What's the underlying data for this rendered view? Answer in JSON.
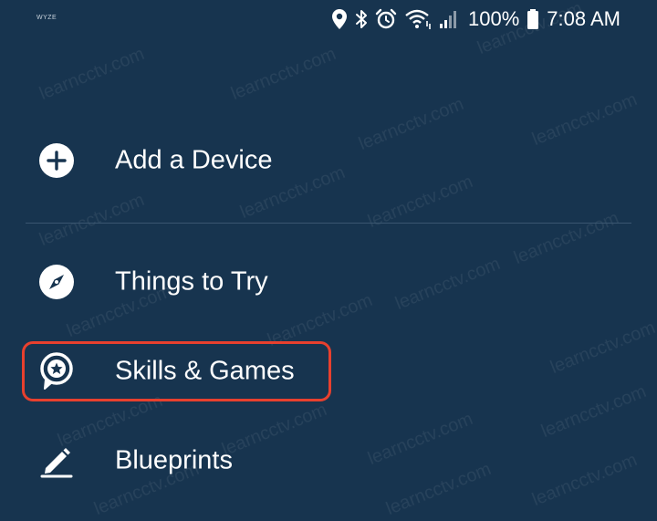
{
  "status_bar": {
    "carrier": "WYZE",
    "battery_percent": "100%",
    "time": "7:08 AM",
    "icons": [
      "location-icon",
      "bluetooth-icon",
      "alarm-icon",
      "wifi-icon",
      "signal-icon",
      "battery-icon"
    ]
  },
  "menu": {
    "items": [
      {
        "label": "Add a Device",
        "icon": "plus-circle-icon"
      },
      {
        "label": "Things to Try",
        "icon": "compass-icon"
      },
      {
        "label": "Skills & Games",
        "icon": "star-bubble-icon",
        "highlighted": true
      },
      {
        "label": "Blueprints",
        "icon": "pencil-icon"
      }
    ]
  },
  "watermark": "learncctv.com",
  "colors": {
    "background": "#17344f",
    "text": "#ffffff",
    "highlight": "#e8402e",
    "divider": "#3a5670"
  }
}
